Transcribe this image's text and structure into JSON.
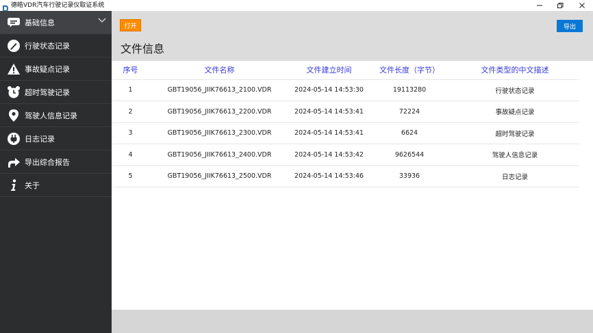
{
  "window": {
    "title": "德皓VDR汽车行驶记录仪取证系统"
  },
  "sidebar": {
    "items": [
      {
        "label": "基础信息",
        "icon": "chat-icon"
      },
      {
        "label": "行驶状态记录",
        "icon": "gauge-icon"
      },
      {
        "label": "事故疑点记录",
        "icon": "warning-icon"
      },
      {
        "label": "超时驾驶记录",
        "icon": "alarm-clock-icon"
      },
      {
        "label": "驾驶人信息记录",
        "icon": "location-pin-icon"
      },
      {
        "label": "日志记录",
        "icon": "plug-icon"
      },
      {
        "label": "导出综合报告",
        "icon": "share-arrow-icon"
      },
      {
        "label": "关于",
        "icon": "info-icon"
      }
    ]
  },
  "toolbar": {
    "open_label": "打开",
    "export_label": "导出"
  },
  "page": {
    "title": "文件信息"
  },
  "table": {
    "headers": [
      "序号",
      "文件名称",
      "文件建立时间",
      "文件长度（字节）",
      "文件类型的中文描述"
    ],
    "rows": [
      [
        "1",
        "GBT19056_JIIK76613_2100.VDR",
        "2024-05-14 14:53:30",
        "19113280",
        "行驶状态记录"
      ],
      [
        "2",
        "GBT19056_JIIK76613_2200.VDR",
        "2024-05-14 14:53:41",
        "72224",
        "事故疑点记录"
      ],
      [
        "3",
        "GBT19056_JIIK76613_2300.VDR",
        "2024-05-14 14:53:41",
        "6624",
        "超时驾驶记录"
      ],
      [
        "4",
        "GBT19056_JIIK76613_2400.VDR",
        "2024-05-14 14:53:42",
        "9626544",
        "驾驶人信息记录"
      ],
      [
        "5",
        "GBT19056_JIIK76613_2500.VDR",
        "2024-05-14 14:53:46",
        "33936",
        "日志记录"
      ]
    ]
  },
  "colors": {
    "sidebar_bg": "#2c2d2f",
    "open_button": "#ff8c00",
    "export_button": "#0a78d7",
    "header_text": "#3a3ad8"
  }
}
